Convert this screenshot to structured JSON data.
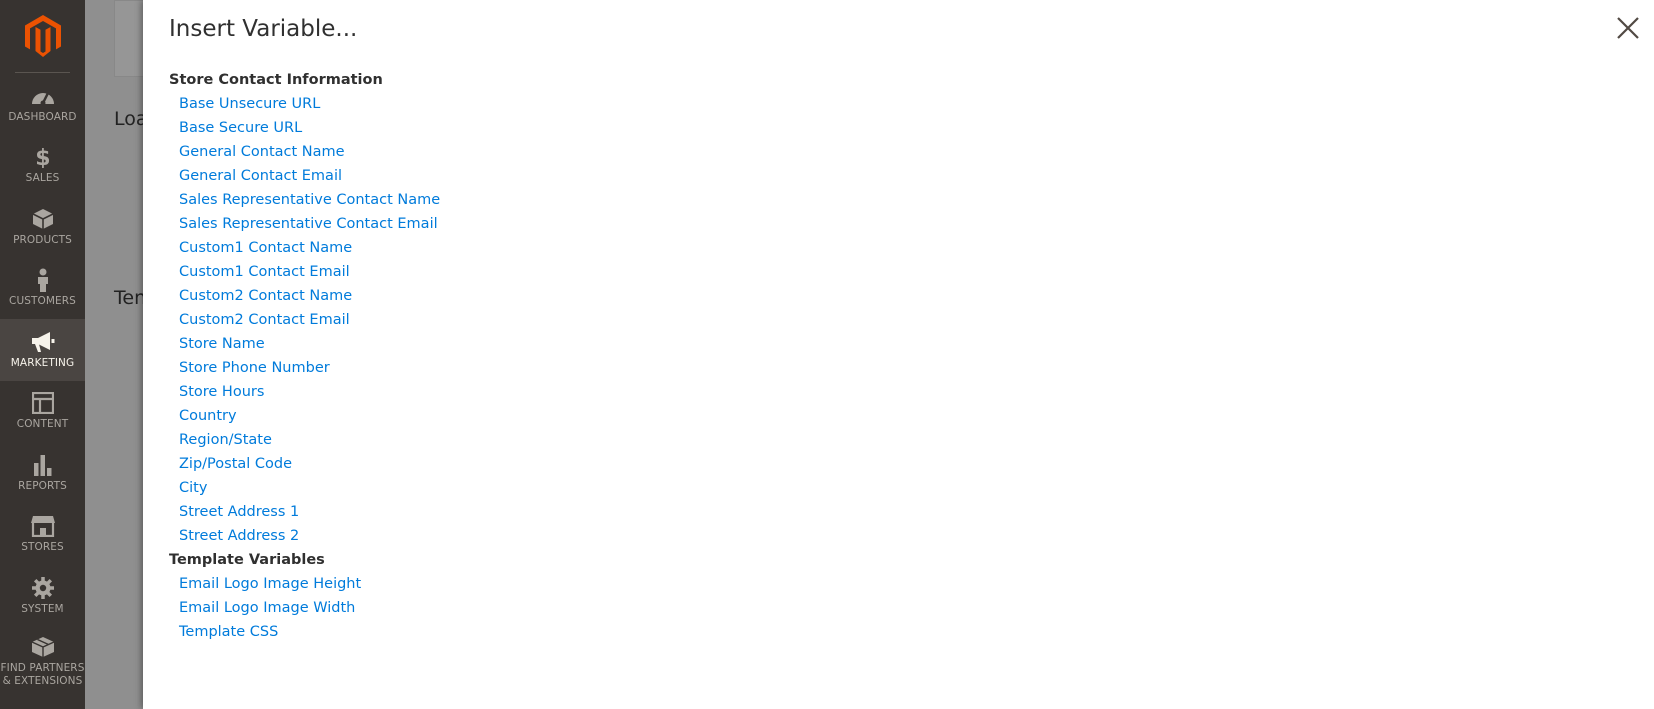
{
  "sidebar": {
    "items": [
      {
        "label": "DASHBOARD",
        "icon": "dashboard-icon"
      },
      {
        "label": "SALES",
        "icon": "dollar-icon"
      },
      {
        "label": "PRODUCTS",
        "icon": "cube-icon"
      },
      {
        "label": "CUSTOMERS",
        "icon": "person-icon"
      },
      {
        "label": "MARKETING",
        "icon": "megaphone-icon"
      },
      {
        "label": "CONTENT",
        "icon": "layout-icon"
      },
      {
        "label": "REPORTS",
        "icon": "bar-chart-icon"
      },
      {
        "label": "STORES",
        "icon": "storefront-icon"
      },
      {
        "label": "SYSTEM",
        "icon": "gear-icon"
      },
      {
        "label": "FIND PARTNERS & EXTENSIONS",
        "icon": "boxes-icon"
      }
    ],
    "active_index": 4
  },
  "background": {
    "text1": "Loa",
    "text2": "Ten"
  },
  "modal": {
    "title": "Insert Variable...",
    "groups": [
      {
        "title": "Store Contact Information",
        "items": [
          "Base Unsecure URL",
          "Base Secure URL",
          "General Contact Name",
          "General Contact Email",
          "Sales Representative Contact Name",
          "Sales Representative Contact Email",
          "Custom1 Contact Name",
          "Custom1 Contact Email",
          "Custom2 Contact Name",
          "Custom2 Contact Email",
          "Store Name",
          "Store Phone Number",
          "Store Hours",
          "Country",
          "Region/State",
          "Zip/Postal Code",
          "City",
          "Street Address 1",
          "Street Address 2"
        ]
      },
      {
        "title": "Template Variables",
        "items": [
          "Email Logo Image Height",
          "Email Logo Image Width",
          "Template CSS"
        ]
      }
    ]
  },
  "colors": {
    "link": "#007bdb",
    "sidebar_bg": "#373330",
    "logo": "#eb5202"
  }
}
